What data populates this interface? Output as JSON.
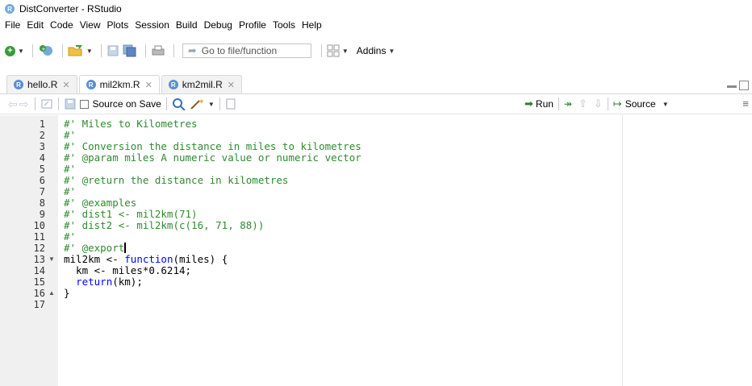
{
  "window": {
    "title": "DistConverter - RStudio",
    "app_icon": "R"
  },
  "menu": [
    "File",
    "Edit",
    "Code",
    "View",
    "Plots",
    "Session",
    "Build",
    "Debug",
    "Profile",
    "Tools",
    "Help"
  ],
  "toolbar": {
    "goto_placeholder": "Go to file/function",
    "addins_label": "Addins"
  },
  "tabs": [
    {
      "label": "hello.R",
      "active": false
    },
    {
      "label": "mil2km.R",
      "active": true
    },
    {
      "label": "km2mil.R",
      "active": false
    }
  ],
  "editor_toolbar": {
    "source_on_save": "Source on Save",
    "source_on_save_checked": false,
    "run_label": "Run",
    "source_label": "Source"
  },
  "editor": {
    "line_numbers": [
      "1",
      "2",
      "3",
      "4",
      "5",
      "6",
      "7",
      "8",
      "9",
      "10",
      "11",
      "12",
      "13",
      "14",
      "15",
      "16",
      "17"
    ],
    "lines": [
      "#' Miles to Kilometres",
      "#'",
      "#' Conversion the distance in miles to kilometres",
      "#' @param miles A numeric value or numeric vector",
      "#'",
      "#' @return the distance in kilometres",
      "#'",
      "#' @examples",
      "#' dist1 <- mil2km(71)",
      "#' dist2 <- mil2km(c(16, 71, 88))",
      "#'",
      "#' @export",
      "mil2km <- function(miles) {",
      "  km <- miles*0.6214;",
      "  return(km);",
      "}",
      ""
    ],
    "fold_lines": [
      "13",
      "16"
    ],
    "cursor_line": "12"
  },
  "colors": {
    "comment": "#2e8b2e",
    "keyword": "#0000ff",
    "gutter_bg": "#f0f0f0",
    "r_blue": "#75AADB"
  }
}
